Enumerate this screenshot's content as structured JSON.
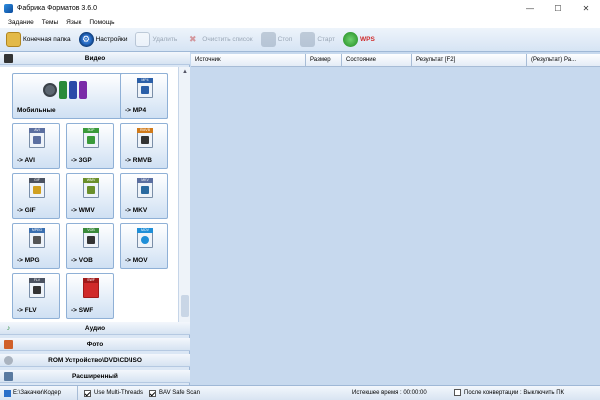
{
  "window": {
    "title": "Фабрика Форматов 3.6.0",
    "controls": [
      "—",
      "☐",
      "✕"
    ]
  },
  "menu": [
    "Задание",
    "Темы",
    "Язык",
    "Помощь"
  ],
  "toolbar": {
    "output_folder": "Конечная папка",
    "settings": "Настройки",
    "remove": "Удалить",
    "clear_list": "Очистить список",
    "stop": "Стоп",
    "start": "Старт",
    "wps": "WPS"
  },
  "left_panel": {
    "video_header": "Видео",
    "tiles": [
      {
        "label": "Мобильные",
        "tag": ""
      },
      {
        "label": "-> MP4",
        "tag": "MP4",
        "color": "#2b5fa8"
      },
      {
        "label": "-> AVI",
        "tag": "AVI",
        "color": "#5b6fa0"
      },
      {
        "label": "-> 3GP",
        "tag": "3GP",
        "color": "#3a9a3a"
      },
      {
        "label": "-> RMVB",
        "tag": "RMVB",
        "color": "#d07a1a"
      },
      {
        "label": "-> GIF",
        "tag": "GIF",
        "color": "#4b5260"
      },
      {
        "label": "-> WMV",
        "tag": "WMV",
        "color": "#6a8f2a"
      },
      {
        "label": "-> MKV",
        "tag": "MKV",
        "color": "#5b6fa0"
      },
      {
        "label": "-> MPG",
        "tag": "MPEG",
        "color": "#3a6fb0"
      },
      {
        "label": "-> VOB",
        "tag": "VOB",
        "color": "#3a8a3a"
      },
      {
        "label": "-> MOV",
        "tag": "MOV",
        "color": "#1f8fd8"
      },
      {
        "label": "-> FLV",
        "tag": "FLV",
        "color": "#4b5260"
      },
      {
        "label": "-> SWF",
        "tag": "SWF",
        "color": "#d02a2a"
      }
    ],
    "audio": "Аудио",
    "photo": "Фото",
    "rom": "ROM Устройство\\DVD\\CD\\ISO",
    "advanced": "Расширенный"
  },
  "table": {
    "columns": [
      "Источник",
      "Размер",
      "Состояние",
      "Результат [F2]",
      "(Результат) Ра..."
    ]
  },
  "status": {
    "path": "E:\\Закачки\\Кодер",
    "multithreads": "Use Multi-Threads",
    "multithreads_checked": true,
    "bav": "BAV Safe Scan",
    "bav_checked": true,
    "elapsed": "Истекшее время : 00:00:00",
    "after_convert": "После конвертации : Выключить ПК",
    "after_checked": false
  }
}
